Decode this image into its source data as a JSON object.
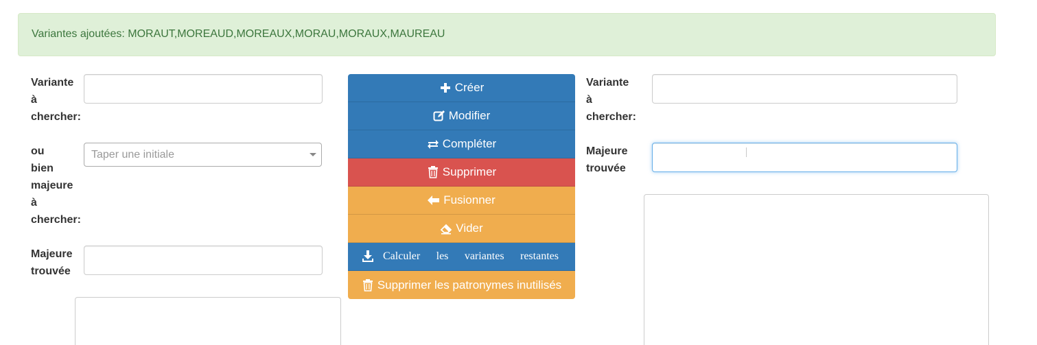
{
  "alert": {
    "text": "Variantes ajoutées: MORAUT,MOREAUD,MOREAUX,MORAU,MORAUX,MAUREAU"
  },
  "left": {
    "variant_label": [
      "Variante",
      "à",
      "chercher:"
    ],
    "variant_value": "",
    "major_search_label": [
      "ou",
      "bien",
      "majeure",
      "à",
      "chercher:"
    ],
    "initial_select_placeholder": "Taper une initiale",
    "major_found_label": [
      "Majeure",
      "trouvée"
    ],
    "major_found_value": ""
  },
  "buttons": {
    "create": "Créer",
    "modify": "Modifier",
    "complete": "Compléter",
    "delete": "Supprimer",
    "merge": "Fusionner",
    "empty": "Vider",
    "compute_words": [
      "Calculer",
      "les",
      "variantes",
      "restantes"
    ],
    "delete_unused": "Supprimer les patronymes inutilisés"
  },
  "right": {
    "variant_label": [
      "Variante",
      "à",
      "chercher:"
    ],
    "variant_value": "",
    "major_found_label": [
      "Majeure",
      "trouvée"
    ],
    "major_found_value": ""
  },
  "colors": {
    "primary": "#337ab7",
    "danger": "#d9534f",
    "warning": "#f0ad4e",
    "success_bg": "#dff0d8",
    "success_text": "#3c763d"
  },
  "icons": {
    "create": "plus-icon",
    "modify": "edit-icon",
    "complete": "transfer-icon",
    "delete": "trash-icon",
    "merge": "arrow-left-icon",
    "empty": "eraser-icon",
    "compute": "download-icon",
    "delete_unused": "trash-icon"
  }
}
